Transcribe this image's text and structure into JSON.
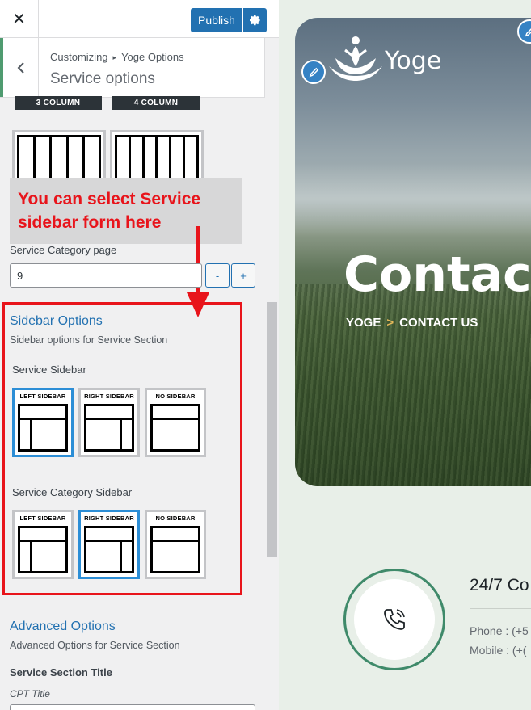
{
  "topbar": {
    "close_glyph": "✕",
    "publish_label": "Publish",
    "settings_icon": "gear-icon"
  },
  "section": {
    "breadcrumb_root": "Customizing",
    "breadcrumb_sep": "▸",
    "breadcrumb_parent": "Yoge Options",
    "title": "Service options"
  },
  "column_layouts": {
    "labels": [
      "3 COLUMN",
      "4 COLUMN"
    ]
  },
  "callout": {
    "text": "You can select Service sidebar form here",
    "color": "#e8141b"
  },
  "category_page": {
    "label": "Service Category page",
    "value": "9",
    "minus": "-",
    "plus": "+"
  },
  "sidebar_options": {
    "title": "Sidebar Options",
    "description": "Sidebar options for Service Section",
    "service_sidebar": {
      "label": "Service Sidebar",
      "options": [
        {
          "caption": "LEFT SIDEBAR",
          "selected": true
        },
        {
          "caption": "RIGHT SIDEBAR",
          "selected": false
        },
        {
          "caption": "NO SIDEBAR",
          "selected": false
        }
      ]
    },
    "category_sidebar": {
      "label": "Service Category Sidebar",
      "options": [
        {
          "caption": "LEFT SIDEBAR",
          "selected": false
        },
        {
          "caption": "RIGHT SIDEBAR",
          "selected": true
        },
        {
          "caption": "NO SIDEBAR",
          "selected": false
        }
      ]
    }
  },
  "advanced_options": {
    "title": "Advanced Options",
    "description": "Advanced Options for Service Section",
    "section_title_label": "Service Section Title",
    "cpt_label": "CPT Title"
  },
  "preview": {
    "logo_text": "Yoge",
    "hero_title": "Contact",
    "crumb_home": "YOGE",
    "crumb_sep": ">",
    "crumb_current": "CONTACT US",
    "contact_title": "24/7 Co",
    "phone_text": "Phone : (+5",
    "mobile_text": "Mobile : (+("
  },
  "colors": {
    "accent": "#2271b1",
    "highlight": "#e8141b",
    "active_border": "#2c8ed6",
    "brand_green": "#3f8a6a"
  }
}
